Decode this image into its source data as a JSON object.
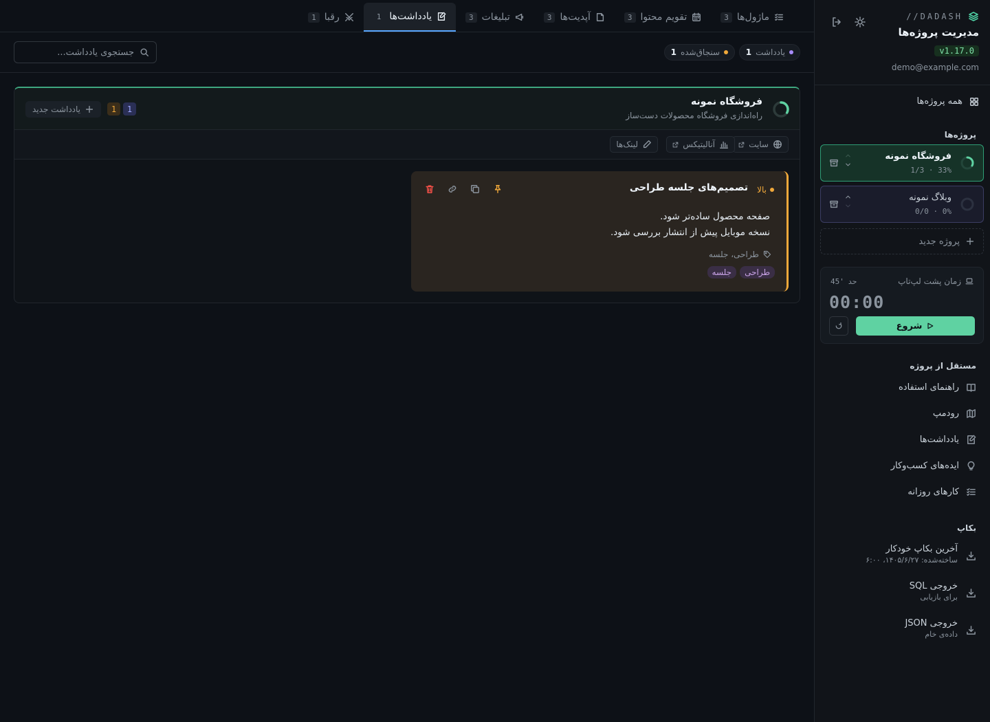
{
  "sidebar": {
    "brand": "//DADASH",
    "title": "مدیریت پروژه‌ها",
    "version": "v1.17.0",
    "email": "demo@example.com",
    "all_projects": "همه پروژه‌ها",
    "projects_label": "پروژه‌ها",
    "projects": [
      {
        "name": "فروشگاه نمونه",
        "meta": "1/3 · 33%",
        "progress": 0.33
      },
      {
        "name": "وبلاگ نمونه",
        "meta": "0/0 · 0%",
        "progress": 0
      }
    ],
    "new_project": "پروژه جدید",
    "timer": {
      "title": "زمان پشت لپ‌تاپ",
      "limit_label": "حد",
      "limit_value": "45'",
      "clock": "00:00",
      "start": "شروع"
    },
    "independent_label": "مستقل از پروژه",
    "nav": [
      {
        "label": "راهنمای استفاده",
        "icon": "book-icon"
      },
      {
        "label": "رودمپ",
        "icon": "map-icon"
      },
      {
        "label": "یادداشت‌ها",
        "icon": "note-icon"
      },
      {
        "label": "ایده‌های کسب‌وکار",
        "icon": "lightbulb-icon"
      },
      {
        "label": "کارهای روزانه",
        "icon": "checklist-icon"
      }
    ],
    "backup_label": "بکاپ",
    "backups": [
      {
        "title": "آخرین بکاپ خودکار",
        "sub": "ساخته‌شده: ۱۴۰۵/۶/۲۷، ۶:۰۰"
      },
      {
        "title": "خروجی SQL",
        "sub": "برای بازیابی"
      },
      {
        "title": "خروجی JSON",
        "sub": "داده‌ی خام"
      }
    ]
  },
  "tabs": [
    {
      "label": "ماژول‌ها",
      "count": "3",
      "icon": "checklist-icon"
    },
    {
      "label": "تقویم محتوا",
      "count": "3",
      "icon": "calendar-icon"
    },
    {
      "label": "آپدیت‌ها",
      "count": "3",
      "icon": "file-icon"
    },
    {
      "label": "تبلیغات",
      "count": "3",
      "icon": "megaphone-icon"
    },
    {
      "label": "یادداشت‌ها",
      "count": "1",
      "icon": "note-icon",
      "active": true
    },
    {
      "label": "رقبا",
      "count": "1",
      "icon": "swords-icon"
    }
  ],
  "filters": {
    "notes_chip": {
      "label": "یادداشت",
      "count": "1",
      "color": "#a78bfa"
    },
    "pinned_chip": {
      "label": "سنجاق‌شده",
      "count": "1",
      "color": "#f0a83a"
    },
    "search_placeholder": "جستجوی یادداشت..."
  },
  "panel": {
    "title": "فروشگاه نمونه",
    "subtitle": "راه‌اندازی فروشگاه محصولات دست‌ساز",
    "progress": 0.33,
    "badge_blue": "1",
    "badge_amber": "1",
    "new_note": "یادداشت جدید",
    "links": [
      {
        "label": "سایت",
        "icon": "globe-icon"
      },
      {
        "label": "آنالیتیکس",
        "icon": "bar-chart-icon"
      },
      {
        "label": "لینک‌ها",
        "icon": "pencil-icon"
      }
    ]
  },
  "note": {
    "priority": "بالا",
    "title": "تصمیم‌های جلسه طراحی",
    "lines": [
      "صفحه محصول ساده‌تر شود.",
      "نسخه موبایل پیش از انتشار بررسی شود."
    ],
    "tags_line": "طراحی، جلسه",
    "tags": [
      "طراحی",
      "جلسه"
    ]
  },
  "colors": {
    "accent": "#5fd2a2",
    "priority_high": "#f0a83a",
    "danger": "#f85149"
  }
}
